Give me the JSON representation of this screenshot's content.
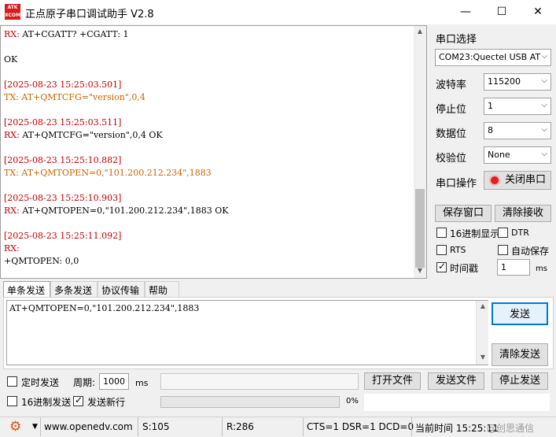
{
  "window": {
    "logo_text": "ATK\nXCOM",
    "title": "正点原子串口调试助手 V2.8",
    "minimize": "—",
    "maximize": "☐",
    "close": "✕"
  },
  "receive": {
    "lines": [
      {
        "cls": "rx",
        "prefix": "RX: ",
        "text": "AT+CGATT? +CGATT: 1"
      },
      {
        "cls": "blank",
        "prefix": "",
        "text": ""
      },
      {
        "cls": "plain",
        "prefix": "",
        "text": "OK"
      },
      {
        "cls": "blank",
        "prefix": "",
        "text": ""
      },
      {
        "cls": "ts",
        "prefix": "[2025-08-23 15:25:03.501]",
        "text": ""
      },
      {
        "cls": "tx",
        "prefix": "TX: ",
        "text": "AT+QMTCFG=\"version\",0,4"
      },
      {
        "cls": "blank",
        "prefix": "",
        "text": ""
      },
      {
        "cls": "ts",
        "prefix": "[2025-08-23 15:25:03.511]",
        "text": ""
      },
      {
        "cls": "rx",
        "prefix": "RX: ",
        "text": "AT+QMTCFG=\"version\",0,4 OK"
      },
      {
        "cls": "blank",
        "prefix": "",
        "text": ""
      },
      {
        "cls": "ts",
        "prefix": "[2025-08-23 15:25:10.882]",
        "text": ""
      },
      {
        "cls": "tx",
        "prefix": "TX: ",
        "text": "AT+QMTOPEN=0,\"101.200.212.234\",1883"
      },
      {
        "cls": "blank",
        "prefix": "",
        "text": ""
      },
      {
        "cls": "ts",
        "prefix": "[2025-08-23 15:25:10.903]",
        "text": ""
      },
      {
        "cls": "rx",
        "prefix": "RX: ",
        "text": "AT+QMTOPEN=0,\"101.200.212.234\",1883 OK"
      },
      {
        "cls": "blank",
        "prefix": "",
        "text": ""
      },
      {
        "cls": "ts",
        "prefix": "[2025-08-23 15:25:11.092]",
        "text": ""
      },
      {
        "cls": "rx",
        "prefix": "RX:",
        "text": ""
      },
      {
        "cls": "plain",
        "prefix": "",
        "text": "+QMTOPEN: 0,0"
      }
    ]
  },
  "port": {
    "section_label": "串口选择",
    "port_value": "COM23:Quectel USB AT",
    "baud_label": "波特率",
    "baud_value": "115200",
    "stop_label": "停止位",
    "stop_value": "1",
    "data_label": "数据位",
    "data_value": "8",
    "parity_label": "校验位",
    "parity_value": "None",
    "op_label": "串口操作",
    "close_port": "关闭串口"
  },
  "rx_options": {
    "save_window": "保存窗口",
    "clear_receive": "清除接收",
    "hex_display": "16进制显示",
    "dtr": "DTR",
    "rts": "RTS",
    "auto_save": "自动保存",
    "timestamp": "时间戳",
    "timestamp_value": "1",
    "ms": "ms",
    "hex_display_checked": false,
    "dtr_checked": false,
    "rts_checked": false,
    "auto_save_checked": false,
    "timestamp_checked": true
  },
  "tabs": [
    "单条发送",
    "多条发送",
    "协议传输",
    "帮助"
  ],
  "send": {
    "text": "AT+QMTOPEN=0,\"101.200.212.234\",1883",
    "send_button": "发送",
    "clear_send": "清除发送",
    "timed_send": "定时发送",
    "period_label": "周期:",
    "period_value": "1000",
    "ms": "ms",
    "open_file": "打开文件",
    "send_file": "发送文件",
    "stop_send": "停止发送",
    "hex_send": "16进制发送",
    "send_newline": "发送新行",
    "progress": "0%",
    "timed_send_checked": false,
    "hex_send_checked": false,
    "send_newline_checked": true
  },
  "status": {
    "website": "www.openedv.com",
    "sent": "S:105",
    "received": "R:286",
    "lines": "CTS=1 DSR=1 DCD=0",
    "time": "当前时间 15:25:11",
    "watermark": "@创思通信"
  },
  "colors": {
    "timestamp": "#c00000",
    "tx": "#c86400",
    "rx": "#c00000",
    "close_port_icon": "#e02020",
    "accent_button": "#0078d7"
  }
}
